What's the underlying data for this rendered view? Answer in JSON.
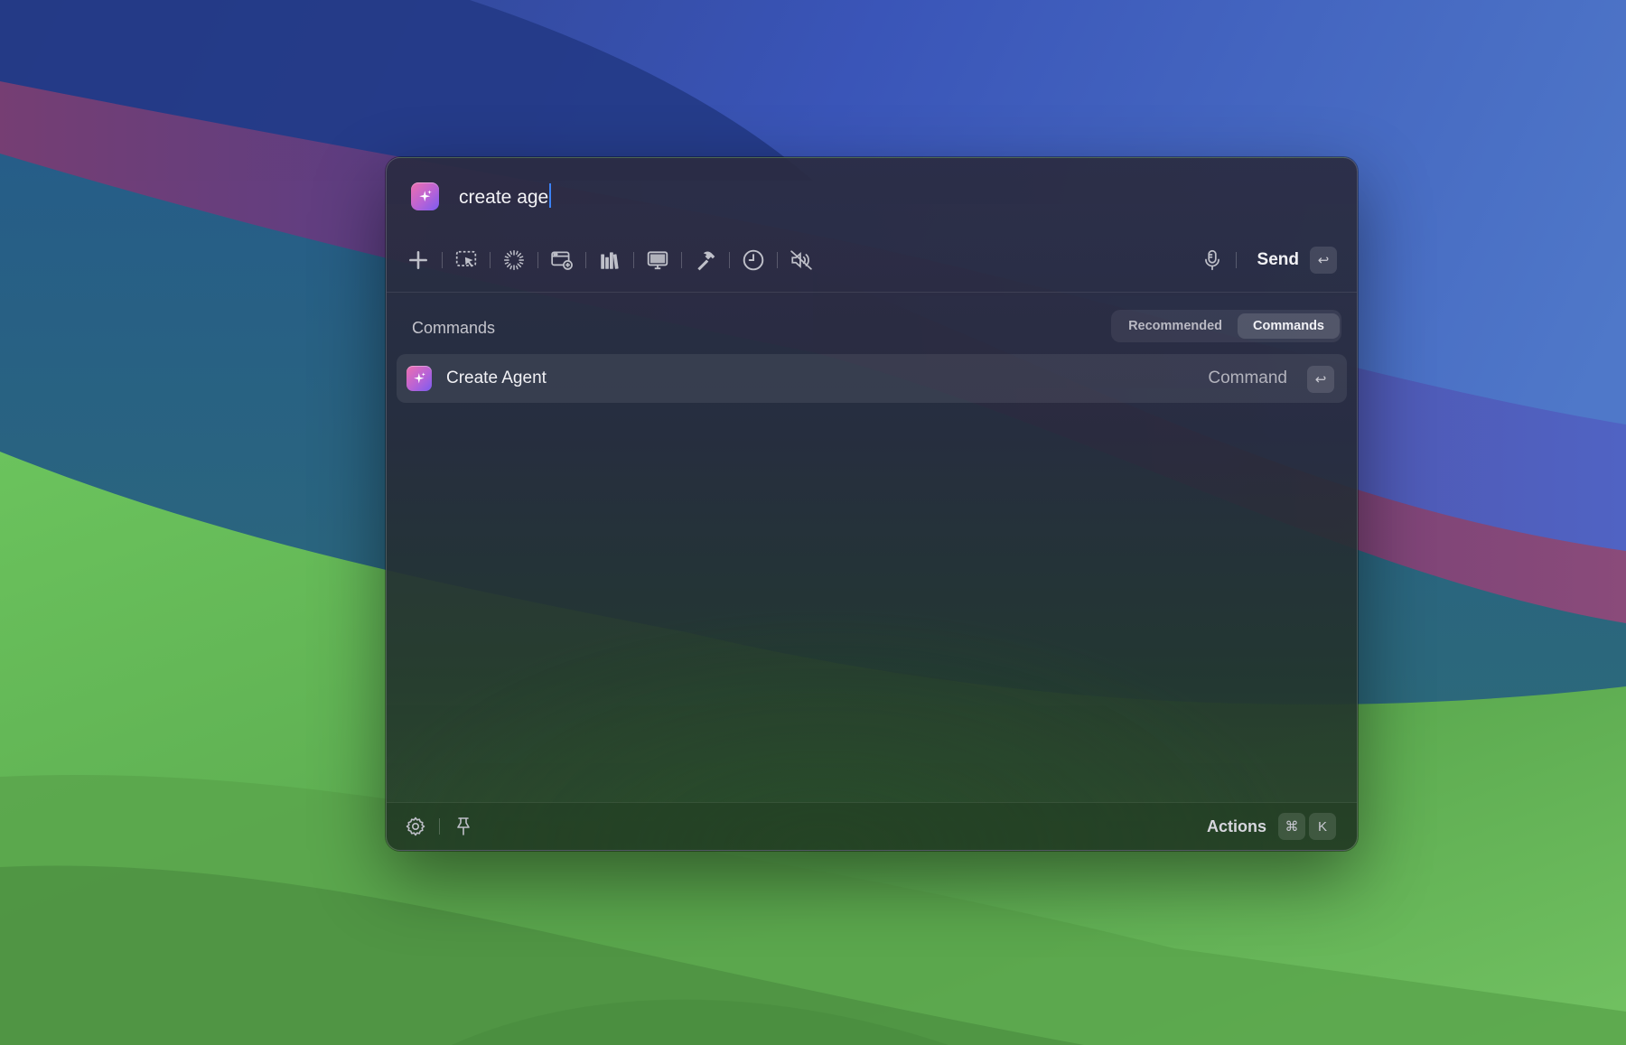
{
  "launcher": {
    "query": "create age",
    "toolbar": {
      "tools": [
        {
          "name": "add-icon"
        },
        {
          "name": "screen-select-icon"
        },
        {
          "name": "loading-spinner-icon"
        },
        {
          "name": "window-add-icon"
        },
        {
          "name": "library-icon"
        },
        {
          "name": "display-icon"
        },
        {
          "name": "hammer-icon"
        },
        {
          "name": "clock-icon"
        },
        {
          "name": "speaker-muted-icon"
        }
      ],
      "mic_icon": "microphone-icon",
      "send_label": "Send",
      "send_key": "↩"
    },
    "section_title": "Commands",
    "segments": [
      {
        "label": "Recommended",
        "active": false
      },
      {
        "label": "Commands",
        "active": true
      }
    ],
    "results": [
      {
        "title": "Create Agent",
        "type": "Command",
        "key": "↩"
      }
    ],
    "footer": {
      "settings_icon": "gear-icon",
      "pin_icon": "pin-icon",
      "actions_label": "Actions",
      "shortcut_modifier": "⌘",
      "shortcut_key": "K"
    }
  },
  "colors": {
    "accent_caret": "#3b82f6",
    "badge_gradient_start": "#ee6fae",
    "badge_gradient_end": "#7b5cf0"
  }
}
